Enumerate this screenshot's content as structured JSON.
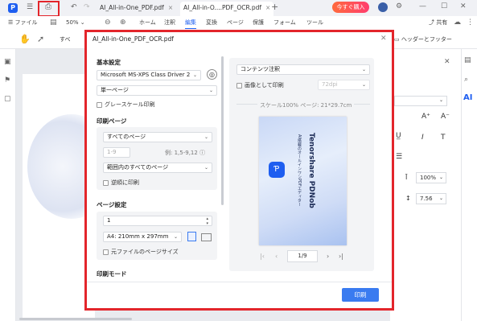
{
  "titlebar": {
    "tabs": [
      {
        "label": "AI_All-in-One_PDF.pdf",
        "active": false
      },
      {
        "label": "AI_All-in-O....PDF_OCR.pdf",
        "active": true
      }
    ],
    "buy_label": "今すぐ購入"
  },
  "menubar": {
    "file_label": "ファイル",
    "zoom": "50%",
    "items": [
      "ホーム",
      "注釈",
      "編集",
      "変換",
      "ページ",
      "保護",
      "フォーム",
      "ツール"
    ],
    "active_item": "編集",
    "share_label": "共有"
  },
  "toolbar": {
    "partial_label": "すべ",
    "header_footer_label": "ヘッダーとフッター"
  },
  "right_panel": {
    "zoom_value": "100%",
    "spacing_value": "7.56"
  },
  "dialog": {
    "title": "AI_All-in-One_PDF_OCR.pdf",
    "basic": {
      "heading": "基本設定",
      "printer": "Microsoft MS-XPS Class Driver 2",
      "sides": "単一ページ",
      "grayscale_label": "グレースケール印刷"
    },
    "print_pages": {
      "heading": "印刷ページ",
      "range": "すべてのページ",
      "pages_placeholder": "1-9",
      "example": "例: 1,5-9,12",
      "subset": "範囲内のすべてのページ",
      "reverse_label": "逆順に印刷"
    },
    "page_setup": {
      "heading": "ページ設定",
      "copies": "1",
      "paper": "A4: 210mm x 297mm",
      "orig_size_label": "元ファイルのページサイズ"
    },
    "print_mode": {
      "heading": "印刷モード"
    },
    "preview": {
      "content": "コンテンツ注釈",
      "as_image_label": "画像として印刷",
      "dpi": "72dpi",
      "scale_info": "スケール100%  ページ: 21*29.7cm",
      "thumb_title": "Tenorshare PDNob",
      "thumb_subtitle": "AI搭載のオールインワンPDFエディター",
      "page_indicator": "1/9"
    },
    "print_button": "印刷"
  },
  "colors": {
    "accent": "#1e5ef0",
    "highlight": "#e3252b",
    "print_button": "#3a7bf0"
  }
}
